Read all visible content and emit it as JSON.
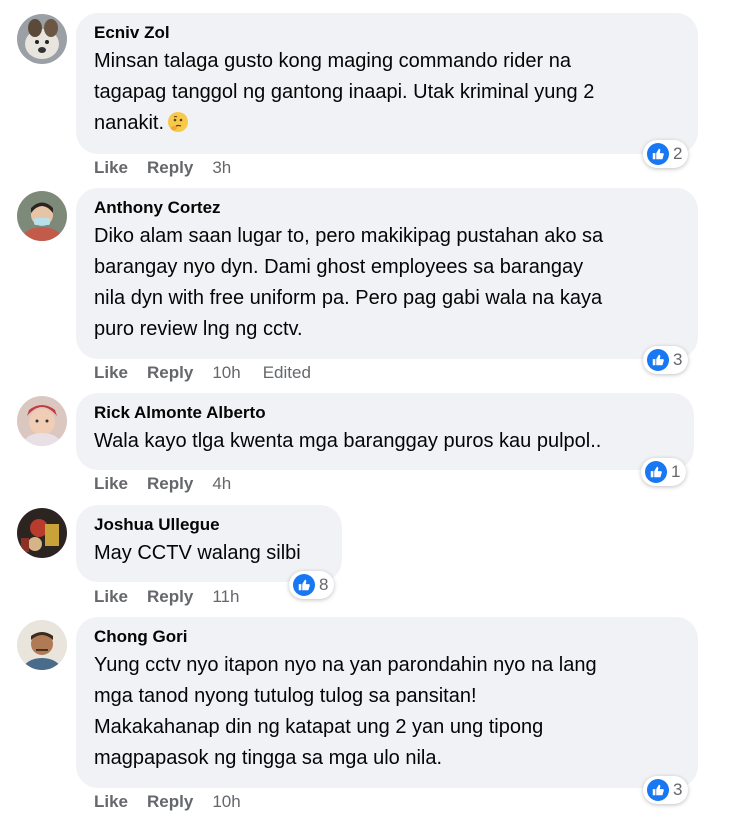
{
  "colors": {
    "bubble": "#f0f2f5",
    "like_blue": "#1877f2",
    "meta": "#65676b"
  },
  "comments": [
    {
      "author": "Ecniv Zol",
      "text": "Minsan talaga gusto kong maging commando rider na\ntagapag tanggol ng gantong inaapi. Utak kriminal yung 2\nnanakit.",
      "emoji": "thinking-face-icon",
      "reaction_count": "2",
      "like": "Like",
      "reply": "Reply",
      "time": "3h"
    },
    {
      "author": "Anthony Cortez",
      "text": "Diko alam saan lugar to, pero makikipag pustahan ako sa\nbarangay nyo dyn. Dami ghost employees sa barangay\nnila dyn with free uniform pa. Pero pag gabi wala na kaya\npuro review lng ng cctv.",
      "reaction_count": "3",
      "like": "Like",
      "reply": "Reply",
      "time": "10h",
      "edited": "Edited"
    },
    {
      "author": "Rick Almonte Alberto",
      "text": "Wala kayo tlga kwenta mga baranggay puros kau pulpol..",
      "reaction_count": "1",
      "like": "Like",
      "reply": "Reply",
      "time": "4h"
    },
    {
      "author": "Joshua Ullegue",
      "text": "May CCTV walang silbi",
      "reaction_count": "8",
      "like": "Like",
      "reply": "Reply",
      "time": "11h"
    },
    {
      "author": "Chong Gori",
      "text": "Yung cctv nyo itapon nyo na yan parondahin nyo na lang\nmga tanod nyong tutulog tulog sa pansitan!\nMakakahanap din ng katapat ung 2 yan ung tipong\nmagpapasok ng tingga sa mga ulo nila.",
      "reaction_count": "3",
      "like": "Like",
      "reply": "Reply",
      "time": "10h"
    }
  ]
}
